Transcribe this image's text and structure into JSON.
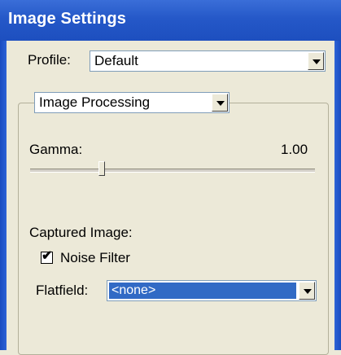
{
  "window": {
    "title": "Image Settings"
  },
  "profile": {
    "label": "Profile:",
    "value": "Default"
  },
  "group": {
    "selector_value": "Image Processing"
  },
  "gamma": {
    "label": "Gamma:",
    "value_text": "1.00",
    "slider_fraction": 0.25
  },
  "captured": {
    "label": "Captured Image:",
    "noise_filter": {
      "label": "Noise Filter",
      "checked": true,
      "checkmark": "✔"
    },
    "flatfield": {
      "label": "Flatfield:",
      "value": "<none>"
    }
  },
  "icons": {
    "dropdown": "chevron-down-icon"
  },
  "colors": {
    "titlebar": "#2558c8",
    "selection": "#316ac5",
    "background": "#ece9d8"
  }
}
